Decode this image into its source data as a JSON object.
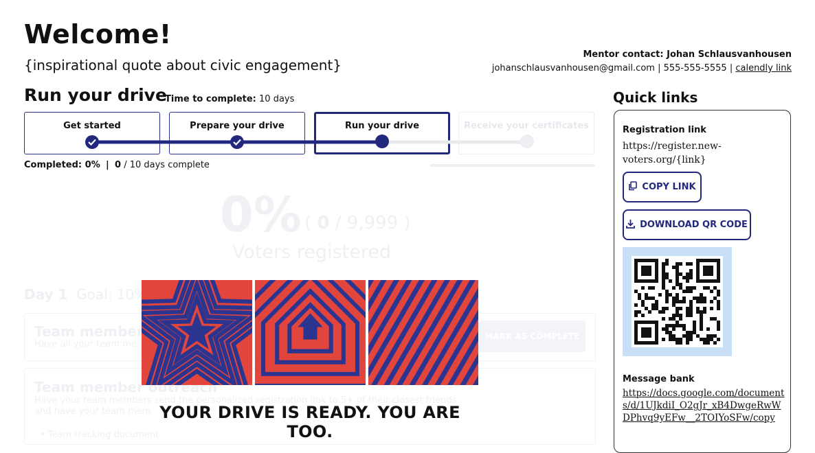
{
  "header": {
    "title": "Welcome!",
    "quote": "{inspirational quote about civic engagement}",
    "mentor_label": "Mentor contact: Johan Schlausvanhousen",
    "mentor_email": "johanschlausvanhousen@gmail.com",
    "mentor_separator": " | ",
    "mentor_phone": "555-555-5555",
    "mentor_link": "calendly link"
  },
  "drive": {
    "title": "Run your drive",
    "time_label": "Time to complete:",
    "time_value": "10 days",
    "steps": [
      {
        "label": "Get started",
        "state": "done"
      },
      {
        "label": "Prepare your drive",
        "state": "done"
      },
      {
        "label": "Run your drive",
        "state": "current"
      },
      {
        "label": "Receive your certificates",
        "state": "upcoming"
      }
    ],
    "completed_label": "Completed: 0%",
    "days_done": "0",
    "days_text": "/ 10 days complete"
  },
  "stats": {
    "percent": "0%",
    "count_open": "(",
    "count_value": "0",
    "count_total": "/ 9,999",
    "count_close": ")",
    "label": "Voters registered"
  },
  "day": {
    "title": "Day 1",
    "goal": "Goal: 10% vo"
  },
  "tasks": [
    {
      "title": "Team member",
      "description": "Have all your team me",
      "button": "MARK AS COMPLETE"
    },
    {
      "title": "Team member outreach",
      "description": "Have your team members send the personalized registration link to 5+ of their closest friends and have your team mem",
      "link": "Team tracking document"
    }
  ],
  "overlay": {
    "tagline": "YOUR DRIVE IS READY. YOU ARE TOO.",
    "colors": {
      "red": "#e2453c",
      "navy": "#2b3590"
    }
  },
  "quick_links": {
    "title": "Quick links",
    "registration_label": "Registration link",
    "registration_url": "https://register.new-voters.org/{link}",
    "copy_button": "COPY LINK",
    "copy_icon": "copy-icon",
    "qr_button": "DOWNLOAD QR CODE",
    "qr_icon": "download-icon",
    "message_bank_label": "Message bank",
    "message_bank_url": "https://docs.google.com/documents/d/1UJkdiI_O2gJr_xB4DwgeRwWDPhvq9yEFw__2TOIYoSFw/copy"
  },
  "colors": {
    "accent": "#23287f",
    "qr_background": "#c7e0f6"
  }
}
